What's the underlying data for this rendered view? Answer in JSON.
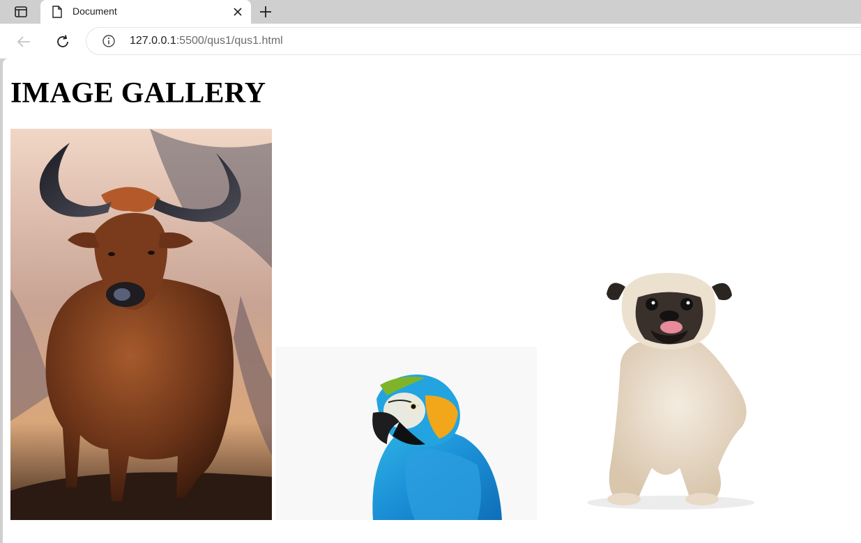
{
  "browser": {
    "tab": {
      "title": "Document"
    },
    "address": {
      "host": "127.0.0.1",
      "path": ":5500/qus1/qus1.html"
    }
  },
  "page": {
    "heading": "IMAGE GALLERY",
    "gallery": [
      {
        "name": "bull-image"
      },
      {
        "name": "parrot-image"
      },
      {
        "name": "pug-image"
      }
    ]
  },
  "icons": {
    "tab_actions": "tab-actions-icon",
    "document": "document-icon",
    "close": "close-icon",
    "new_tab": "plus-icon",
    "back": "back-arrow-icon",
    "reload": "reload-icon",
    "site_info": "info-icon"
  }
}
